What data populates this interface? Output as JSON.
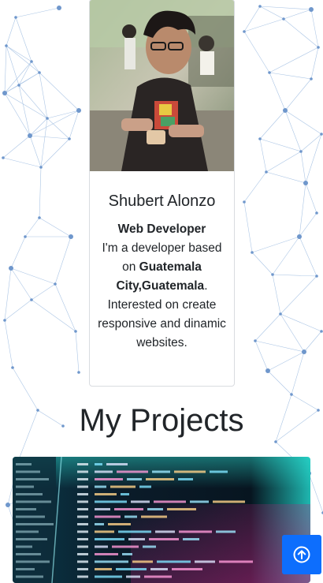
{
  "profile": {
    "name": "Shubert Alonzo",
    "role": "Web Developer",
    "bio_prefix": "I'm a developer based on ",
    "location": "Guatemala City,Guatemala",
    "bio_suffix": ". Interested on create responsive and dinamic websites."
  },
  "projects": {
    "title": "My Projects"
  },
  "icons": {
    "scroll_top": "arrow-up-circle-icon"
  },
  "colors": {
    "accent": "#0d6efd",
    "network": "#8fb2dc"
  }
}
